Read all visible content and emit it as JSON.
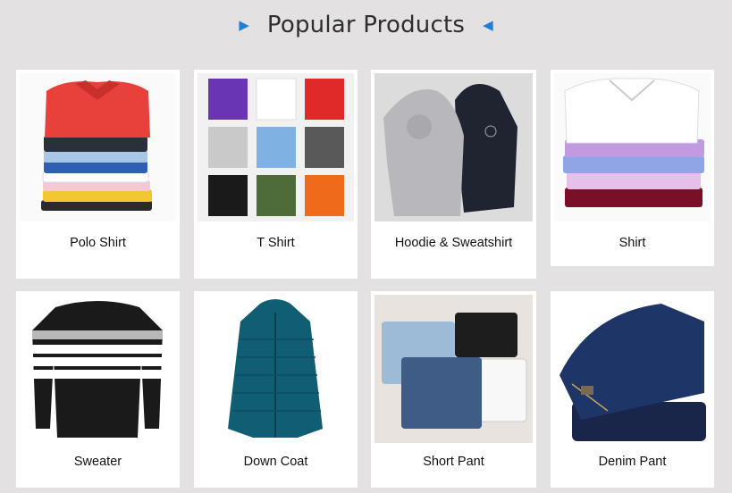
{
  "section": {
    "title": "Popular Products",
    "arrow_left_icon": "triangle-right",
    "arrow_right_icon": "triangle-left",
    "accent_color": "#1e7fd8"
  },
  "products": [
    {
      "label": "Polo Shirt"
    },
    {
      "label": "T Shirt"
    },
    {
      "label": "Hoodie & Sweatshirt"
    },
    {
      "label": "Shirt"
    },
    {
      "label": "Sweater"
    },
    {
      "label": "Down Coat"
    },
    {
      "label": "Short Pant"
    },
    {
      "label": "Denim Pant"
    }
  ]
}
